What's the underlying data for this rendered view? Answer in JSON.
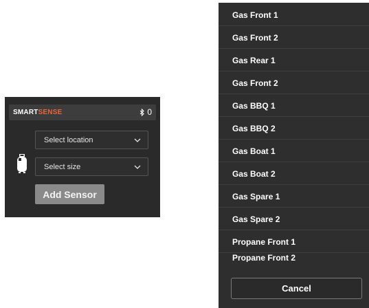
{
  "widget": {
    "brand_part1": "SMART",
    "brand_part2": "SENSE",
    "bluetooth_count": "0",
    "location_select": {
      "value": "Select location"
    },
    "size_select": {
      "value": "Select size"
    },
    "add_button_label": "Add Sensor",
    "icons": [
      "bluetooth-icon",
      "chevron-down-icon",
      "gas-tank-icon"
    ],
    "colors": {
      "brand_accent": "#e8663a",
      "panel_bg": "#2a2a2a",
      "button_bg": "#8a8a8a"
    }
  },
  "dropdown": {
    "options": [
      "Gas Front 1",
      "Gas Front 2",
      "Gas Rear 1",
      "Gas Front 2",
      "Gas BBQ 1",
      "Gas BBQ 2",
      "Gas Boat 1",
      "Gas Boat 2",
      "Gas Spare 1",
      "Gas Spare 2",
      "Propane Front 1",
      "Propane Front 2"
    ],
    "cancel_label": "Cancel"
  }
}
